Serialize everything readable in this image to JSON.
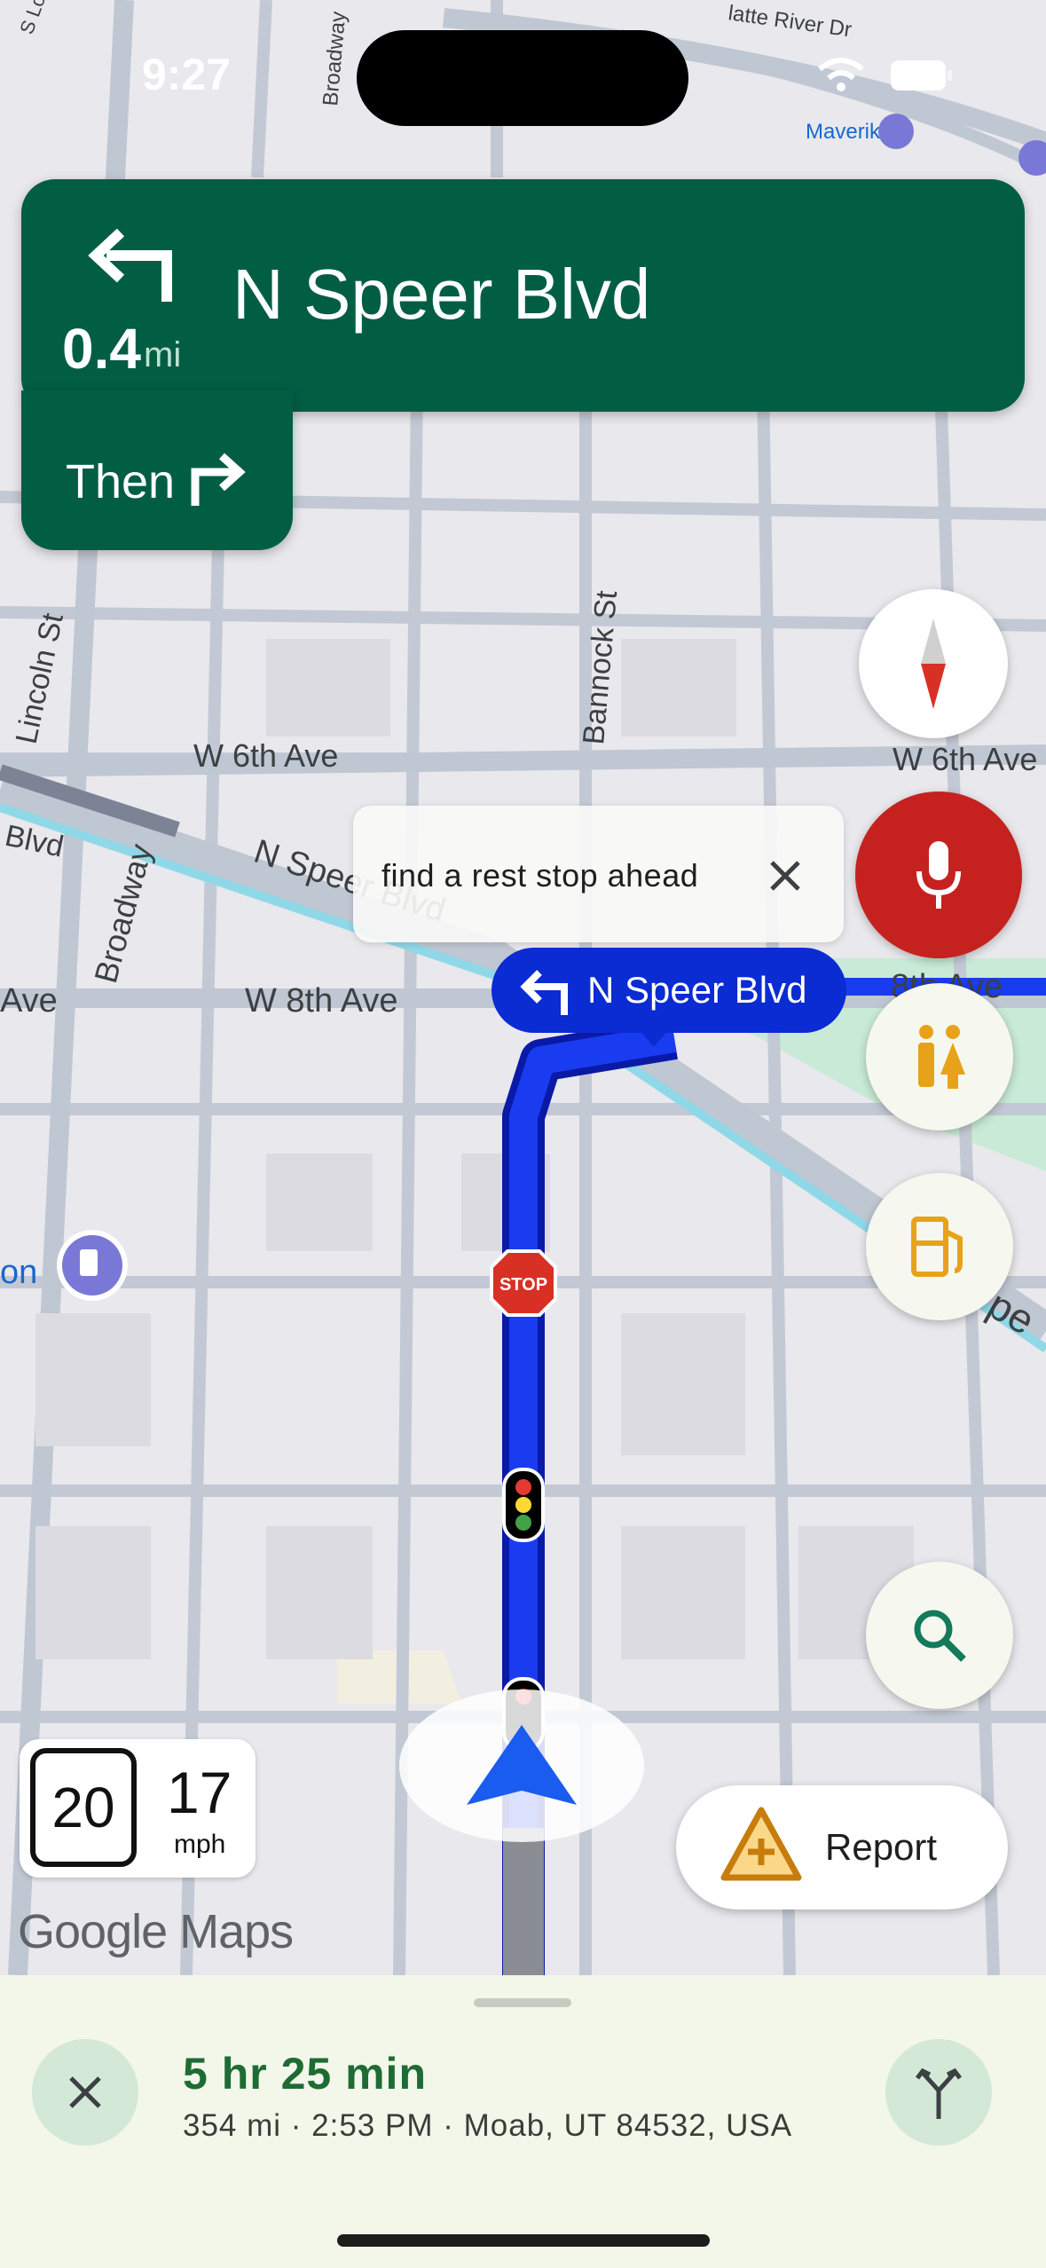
{
  "status_bar": {
    "time": "9:27"
  },
  "map": {
    "street_labels": [
      "W 6th Ave",
      "W 6th Ave",
      "N Speer Blvd",
      "W 8th Ave",
      "8th Ave",
      "Ave",
      "Blvd",
      "Broadway",
      "Broadway",
      "Lincoln St",
      "Bannock St",
      "Maverik",
      "S Logan",
      "latte River Dr",
      "on",
      "pe"
    ],
    "poi_label": "Maverik",
    "stop_sign": "STOP"
  },
  "navigation": {
    "distance": "0.4",
    "distance_unit": "mi",
    "street": "N Speer Blvd",
    "then_label": "Then"
  },
  "suggestion": {
    "text": "find a rest stop ahead"
  },
  "route_label": {
    "street": "N Speer Blvd"
  },
  "speed": {
    "limit": "20",
    "current": "17",
    "unit": "mph"
  },
  "logo": "Google Maps",
  "report": {
    "label": "Report"
  },
  "trip": {
    "eta_duration": "5 hr 25 min",
    "summary": "354 mi · 2:53 PM · Moab, UT 84532, USA"
  },
  "colors": {
    "nav_green": "#015e43",
    "route_blue": "#0b2bd3",
    "mic_red": "#c5221f",
    "eta_green": "#1e6c34",
    "panel_bg": "#f2f7ea"
  }
}
